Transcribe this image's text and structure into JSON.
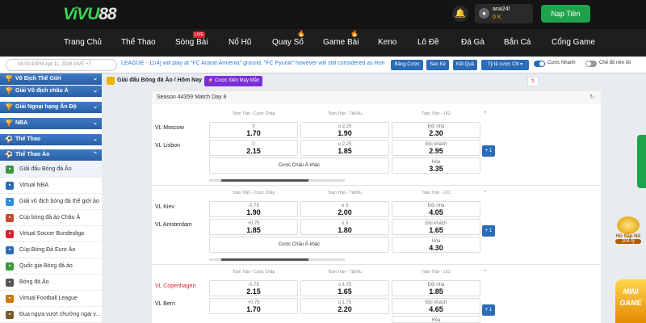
{
  "brand": {
    "logo_main": "ViVU",
    "logo_num": "88"
  },
  "header": {
    "username": "ana24!",
    "balance": "0 K",
    "deposit_label": "Nạp Tiền"
  },
  "nav": [
    {
      "label": "Trang Chủ"
    },
    {
      "label": "Thể Thao"
    },
    {
      "label": "Sòng Bài",
      "badge": "LIVE"
    },
    {
      "label": "Nổ Hũ"
    },
    {
      "label": "Quay Số"
    },
    {
      "label": "Game Bài"
    },
    {
      "label": "Keno"
    },
    {
      "label": "Lô Đề"
    },
    {
      "label": "Đá Gà"
    },
    {
      "label": "Bắn Cá"
    },
    {
      "label": "Cổng Game"
    }
  ],
  "ticker": {
    "time": "08:03:43PM Apr 11, 2026 GMT +7",
    "message": "LEAGUE - 11/4] will play at \"FC Ararat-Armenia\" ground. \"FC Pyunik\" however will still considered as Home",
    "buttons": [
      "Bảng Cược",
      "Sao Kê",
      "Kết Quả",
      "Tỷ lệ cược CN ▾"
    ],
    "toggle_quick": "Cược Nhanh",
    "toggle_mode": "Chế độ nền tối"
  },
  "sidebar": {
    "groups": [
      "Vô Địch Thế Giới",
      "Giải Vô địch châu Á",
      "Giải Ngoại hạng Ấn Độ",
      "NBA",
      "Thể Thao",
      "Thể Thao Ảo"
    ],
    "items": [
      "Giải đấu Bóng đá Ảo",
      "Virtual NBA",
      "Giải vô địch bóng đá thế giới ảo",
      "Cúp bóng đá ảo Châu Á",
      "Virtual Soccer Bundesliga",
      "Cúp Bóng Đá Euro Ảo",
      "Quốc gia Bóng đá ảo",
      "Bóng đá Ảo",
      "Virtual Football League",
      "Đua ngựa vượt chướng ngại v..."
    ]
  },
  "main": {
    "breadcrumb": "Giải đấu Bóng đá Ảo / Hôm Nay",
    "mix_label": "Cược Xiên May Mắn",
    "season": "Season 44359 Match Day 8",
    "col_handicap": "Toàn Trận - Cược Chấp",
    "col_ou": "Toàn Trận - Tài/Xỉu",
    "col_1x2": "Toàn Trận - 1X2",
    "more_label": "Cược Châu Á khác",
    "home_label": "Đội nhà",
    "away_label": "Đội khách",
    "draw_label": "Hòa",
    "matches": [
      {
        "home": "VL Moscow",
        "away": "VL Lisbon",
        "hcp_h": "0",
        "hcp_h_odds": "1.70",
        "hcp_a": "0",
        "hcp_a_odds": "2.15",
        "ou_o": "o 2.25",
        "ou_o_odds": "1.90",
        "ou_u": "u 2.25",
        "ou_u_odds": "1.85",
        "x_home": "2.30",
        "x_away": "2.95",
        "x_draw": "3.35",
        "plus": "+ 1"
      },
      {
        "home": "VL Kiev",
        "away": "VL Amsterdam",
        "hcp_h": "-0.75",
        "hcp_h_odds": "1.90",
        "hcp_a": "+0.75",
        "hcp_a_odds": "1.85",
        "ou_o": "o 3",
        "ou_o_odds": "2.00",
        "ou_u": "u 3",
        "ou_u_odds": "1.80",
        "x_home": "4.05",
        "x_away": "1.65",
        "x_draw": "4.30",
        "plus": "+ 1"
      },
      {
        "home": "VL Copenhagen",
        "away": "VL Bern",
        "hcp_h": "-0.75",
        "hcp_h_odds": "2.15",
        "hcp_a": "+0.75",
        "hcp_a_odds": "1.70",
        "ou_o": "o 1.75",
        "ou_o_odds": "1.65",
        "ou_u": "u 1.75",
        "ou_u_odds": "2.20",
        "x_home": "1.85",
        "x_away": "4.65",
        "x_draw": "",
        "plus": "+ 1"
      }
    ]
  },
  "promo": {
    "title": "Hũ Sắp Nổ",
    "value": "204 tỷ",
    "mini": "MINI GAME"
  },
  "colors": {
    "accent": "#1fa34a",
    "nav_bg": "#1e1e1e",
    "blue": "#2b6cb8",
    "purple": "#7b2fd9"
  }
}
